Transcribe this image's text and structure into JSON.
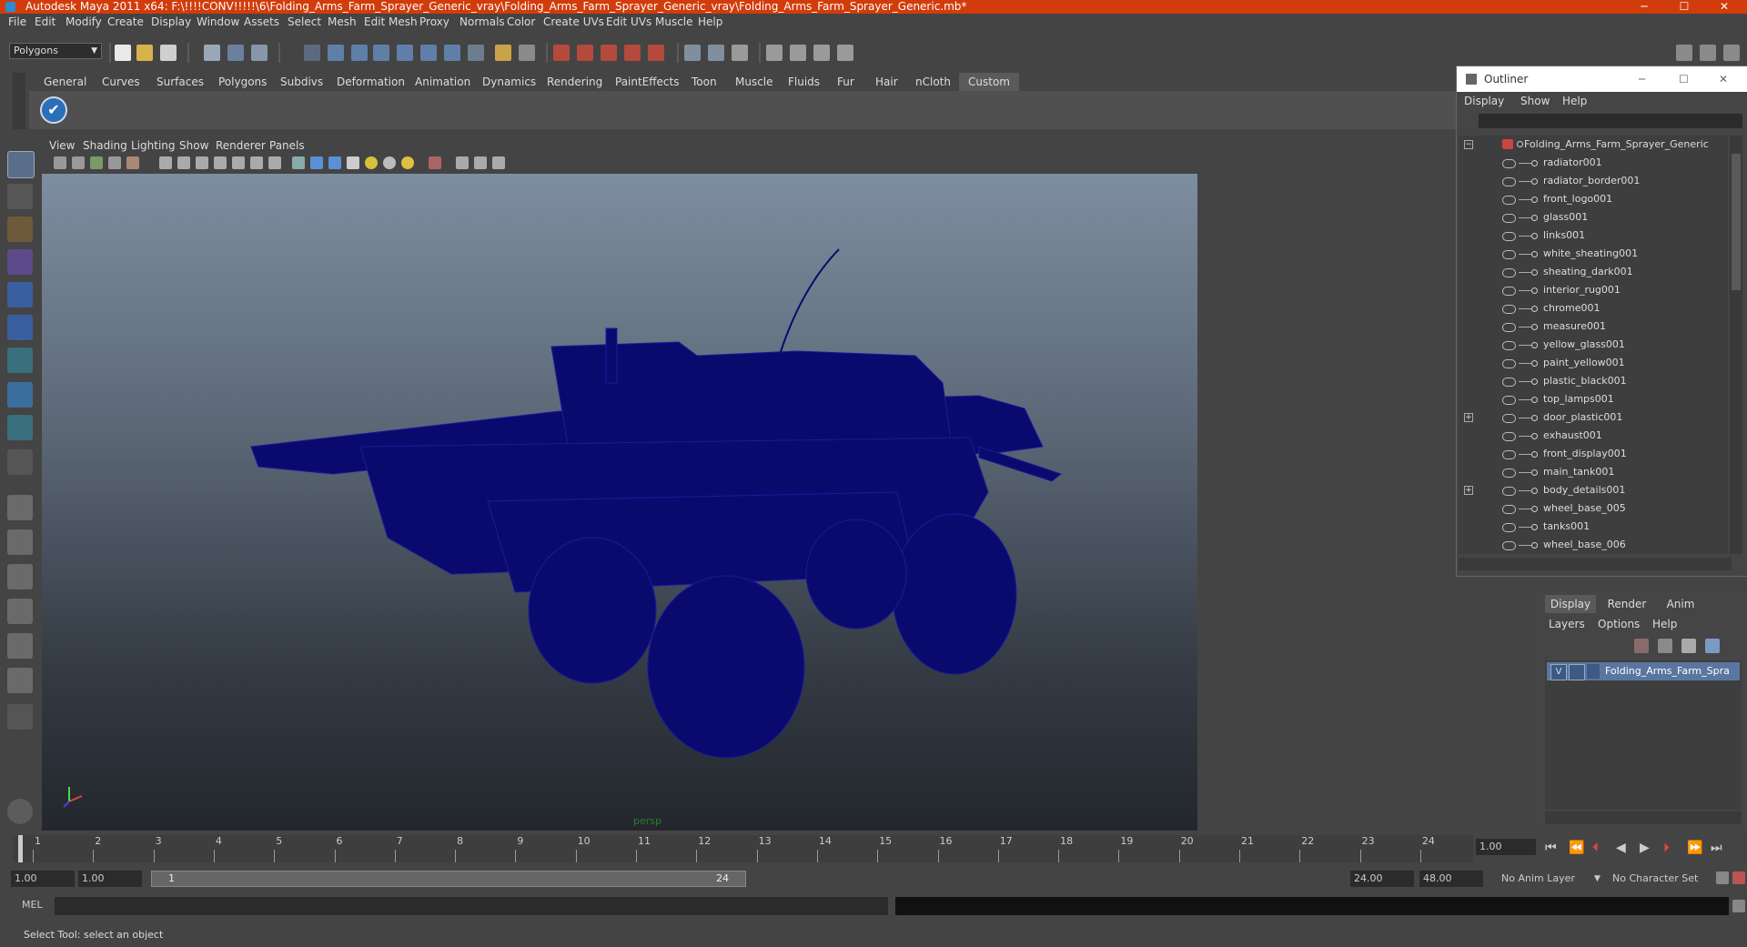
{
  "window": {
    "title": "Autodesk Maya 2011 x64: F:\\!!!!CONV!!!!!\\6\\Folding_Arms_Farm_Sprayer_Generic_vray\\Folding_Arms_Farm_Sprayer_Generic_vray\\Folding_Arms_Farm_Sprayer_Generic.mb*",
    "minimize": "─",
    "maximize": "☐",
    "close": "✕",
    "accent": "#d23c0b"
  },
  "menubar": [
    "File",
    "Edit",
    "Modify",
    "Create",
    "Display",
    "Window",
    "Assets",
    "Select",
    "Mesh",
    "Edit Mesh",
    "Proxy",
    "Normals",
    "Color",
    "Create UVs",
    "Edit UVs",
    "Muscle",
    "Help"
  ],
  "mode_selector": "Polygons",
  "shelf_tabs": [
    "General",
    "Curves",
    "Surfaces",
    "Polygons",
    "Subdivs",
    "Deformation",
    "Animation",
    "Dynamics",
    "Rendering",
    "PaintEffects",
    "Toon",
    "Muscle",
    "Fluids",
    "Fur",
    "Hair",
    "nCloth",
    "Custom"
  ],
  "shelf_active": "Custom",
  "viewport": {
    "menu": [
      "View",
      "Shading",
      "Lighting",
      "Show",
      "Renderer",
      "Panels"
    ],
    "camera_label": "persp",
    "mesh_color": "#0a0a6e"
  },
  "outliner": {
    "title": "Outliner",
    "menu": [
      "Display",
      "Show",
      "Help"
    ],
    "root": "Folding_Arms_Farm_Sprayer_Generic",
    "items": [
      "radiator001",
      "radiator_border001",
      "front_logo001",
      "glass001",
      "links001",
      "white_sheating001",
      "sheating_dark001",
      "interior_rug001",
      "chrome001",
      "measure001",
      "yellow_glass001",
      "paint_yellow001",
      "plastic_black001",
      "top_lamps001",
      "door_plastic001",
      "exhaust001",
      "front_display001",
      "main_tank001",
      "body_details001",
      "wheel_base_005",
      "tanks001",
      "wheel_base_006"
    ]
  },
  "layer_editor": {
    "tabs": [
      "Display",
      "Render",
      "Anim"
    ],
    "menu": [
      "Layers",
      "Options",
      "Help"
    ],
    "layer_visible": "V",
    "layer_name": "Folding_Arms_Farm_Spra"
  },
  "timeline": {
    "ticks": [
      "1",
      "2",
      "3",
      "4",
      "5",
      "6",
      "7",
      "8",
      "9",
      "10",
      "11",
      "12",
      "13",
      "14",
      "15",
      "16",
      "17",
      "18",
      "19",
      "20",
      "21",
      "22",
      "23",
      "24"
    ],
    "current_frame": "1.00"
  },
  "range": {
    "start": "1.00",
    "playback_start": "1.00",
    "slider_start": "1",
    "slider_end": "24",
    "playback_end": "24.00",
    "end": "48.00",
    "anim_layer": "No Anim Layer",
    "character_set": "No Character Set"
  },
  "command_line": {
    "label": "MEL"
  },
  "help_line": "Select Tool: select an object"
}
